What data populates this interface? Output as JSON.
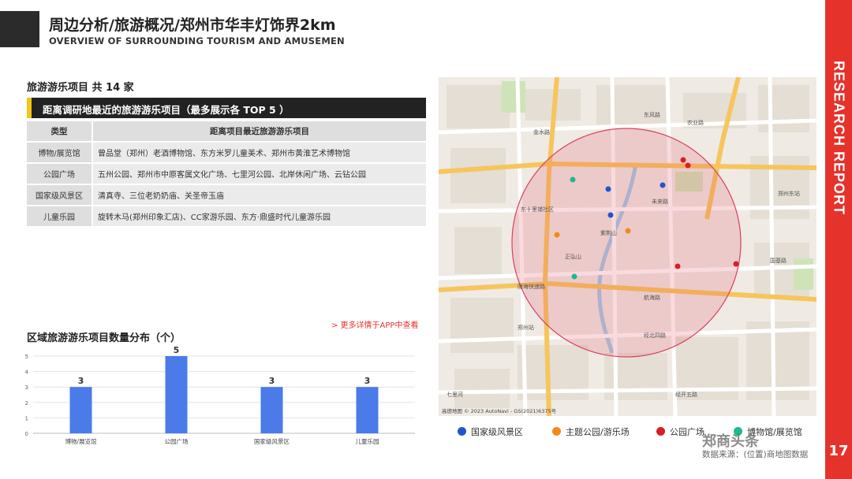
{
  "header": {
    "title": "周边分析/旅游概况/郑州市华丰灯饰界2km",
    "subtitle": "OVERVIEW OF SURROUNDING TOURISM AND AMUSEMEN"
  },
  "sidebar": {
    "label": "RESEARCH REPORT",
    "page_number": "17"
  },
  "summary": {
    "count_label": "旅游游乐项目 共 14 家"
  },
  "table": {
    "title": "距离调研地最近的旅游游乐项目（最多展示各 TOP 5 ）",
    "headers": [
      "类型",
      "距离项目最近旅游游乐项目"
    ],
    "rows": [
      {
        "type": "博物/展览馆",
        "items": "曾品堂（郑州）老酒博物馆、东方米罗儿童美术、郑州市黄淮艺术博物馆"
      },
      {
        "type": "公园广场",
        "items": "五州公园、郑州市中原客属文化广场、七里河公园、北岸休闲广场、云钻公园"
      },
      {
        "type": "国家级风景区",
        "items": "清真寺、三位老奶奶庙、关圣帝玉庙"
      },
      {
        "type": "儿童乐园",
        "items": "旋转木马(郑州印象汇店)、CC家游乐园、东方·鼎盛时代儿童游乐园"
      }
    ]
  },
  "more_link": "> 更多详情于APP中查看",
  "chart_data": {
    "type": "bar",
    "title": "区域旅游游乐项目数量分布（个）",
    "categories": [
      "博物/展览馆",
      "公园广场",
      "国家级风景区",
      "儿童乐园"
    ],
    "values": [
      3,
      5,
      3,
      3
    ],
    "ylim": [
      0,
      5
    ],
    "yticks": [
      "0",
      "1",
      "2",
      "3",
      "4",
      "5"
    ],
    "grid": true,
    "bar_color": "#4a7be8"
  },
  "map": {
    "labels": [
      "金水路",
      "东风路",
      "农业路",
      "东十里铺社区",
      "正弘山",
      "郑州站",
      "郑州东站",
      "紫荆山",
      "未来路",
      "国基路",
      "七里河",
      "陇海快速路",
      "经北四路",
      "经开五路",
      "航海路"
    ],
    "attribution": "高德地图  © 2023 AutoNavi - GS(2021)6375号"
  },
  "legend": [
    {
      "label": "国家级风景区",
      "color": "#2255cc"
    },
    {
      "label": "主题公园/游乐场",
      "color": "#f28a1a"
    },
    {
      "label": "公园广场",
      "color": "#d81f26"
    },
    {
      "label": "博物馆/展览馆",
      "color": "#1fb890"
    }
  ],
  "watermark": "郑商头条",
  "source": "数据来源：(位置)商地图数据"
}
